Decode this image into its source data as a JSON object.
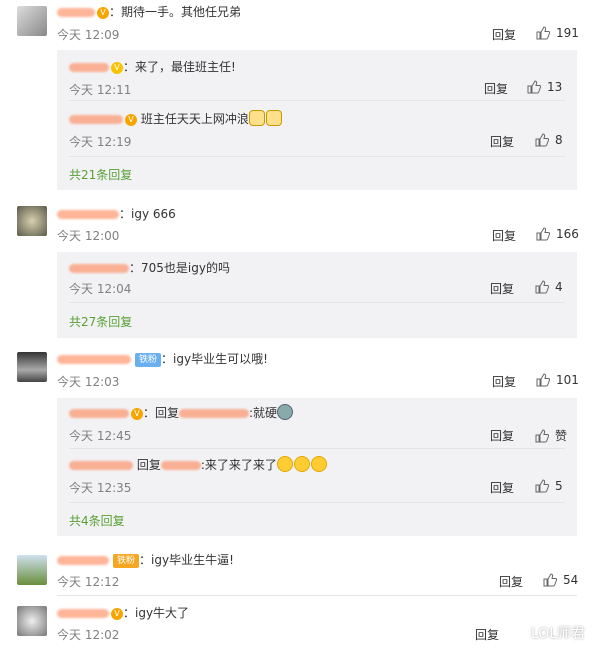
{
  "labels": {
    "reply": "回复",
    "like_icon": "thumb-up-icon",
    "vip_badge": "V"
  },
  "comments": [
    {
      "text": "：期待一手。其他任兄弟",
      "time": "今天 12:09",
      "likes": "191",
      "replies": [
        {
          "text": "：来了，最佳班主任!",
          "time": "今天 12:11",
          "likes": "13"
        },
        {
          "text": "班主任天天上网冲浪",
          "time": "今天 12:19",
          "likes": "8"
        }
      ],
      "more": "共21条回复"
    },
    {
      "text": "：igy 666",
      "time": "今天 12:00",
      "likes": "166",
      "replies": [
        {
          "text": "：705也是igy的吗",
          "time": "今天 12:04",
          "likes": "4"
        }
      ],
      "more": "共27条回复"
    },
    {
      "badge": "铁粉",
      "text": "：igy毕业生可以哦!",
      "time": "今天 12:03",
      "likes": "101",
      "replies": [
        {
          "prefix": "：回复",
          "text": ":就硬",
          "time": "今天 12:45",
          "likes": "赞"
        },
        {
          "prefix": "回复",
          "text": ":来了来了来了",
          "time": "今天 12:35",
          "likes": "5"
        }
      ],
      "more": "共4条回复"
    },
    {
      "badge": "铁粉",
      "text": "：igy毕业生牛逼!",
      "time": "今天 12:12",
      "likes": "54"
    },
    {
      "text": "：igy牛大了",
      "time": "今天 12:02",
      "likes": ""
    }
  ],
  "watermark": "LOL师君"
}
